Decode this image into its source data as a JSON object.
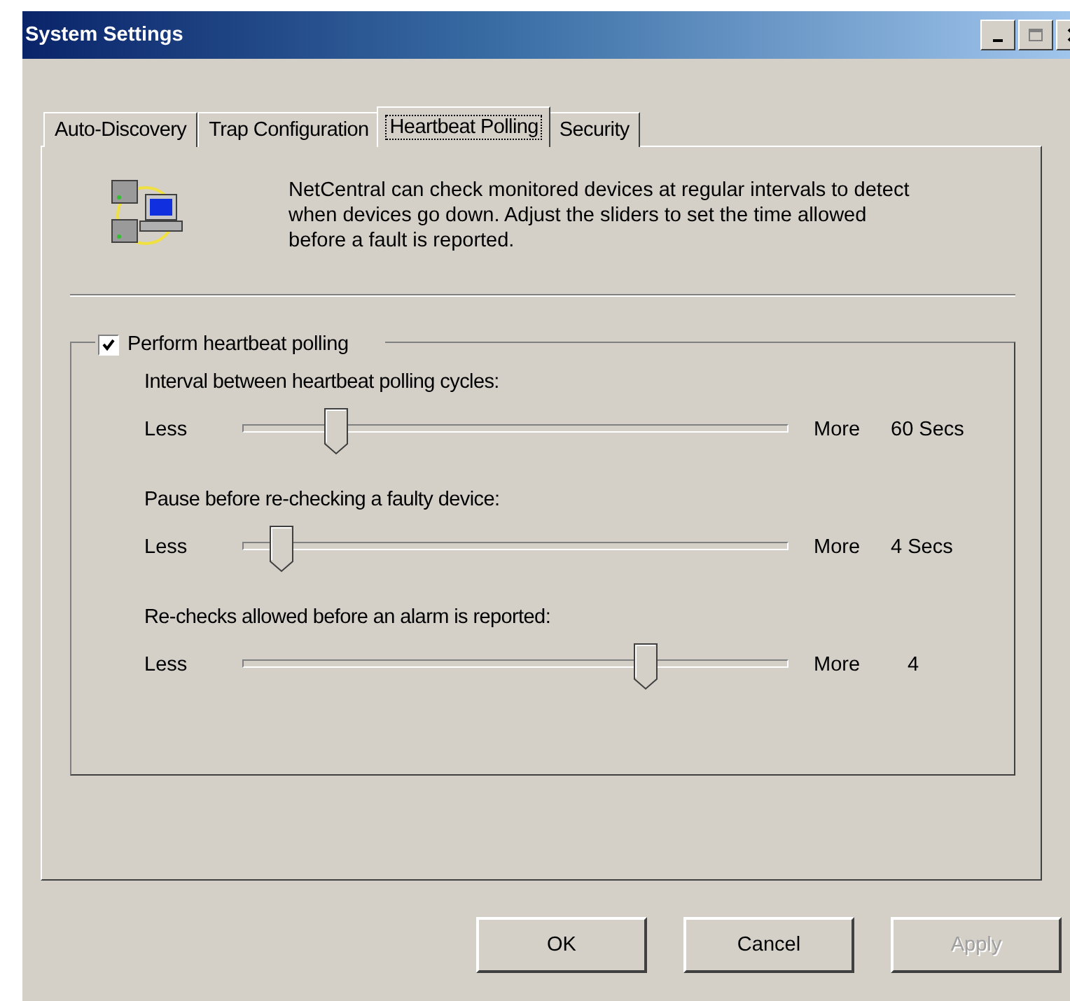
{
  "window": {
    "title": "System Settings"
  },
  "tabs": [
    {
      "label": "Auto-Discovery",
      "selected": false
    },
    {
      "label": "Trap Configuration",
      "selected": false
    },
    {
      "label": "Heartbeat Polling",
      "selected": true
    },
    {
      "label": "Security",
      "selected": false
    }
  ],
  "intro": "NetCentral can check monitored devices at regular intervals to detect when devices go down. Adjust the sliders to set the time allowed before a fault is reported.",
  "group": {
    "label": "Perform heartbeat polling",
    "checked": true
  },
  "sliders": [
    {
      "label": "Interval between heartbeat polling cycles:",
      "min_label": "Less",
      "max_label": "More",
      "level": 0.17,
      "reading": "60 Secs"
    },
    {
      "label": "Pause before re-checking a faulty device:",
      "min_label": "Less",
      "max_label": "More",
      "level": 0.07,
      "reading": "4 Secs"
    },
    {
      "label": "Re-checks allowed before an alarm is reported:",
      "min_label": "Less",
      "max_label": "More",
      "level": 0.74,
      "reading": "4"
    }
  ],
  "buttons": [
    {
      "label": "OK",
      "disabled": false
    },
    {
      "label": "Cancel",
      "disabled": false
    },
    {
      "label": "Apply",
      "disabled": true
    }
  ]
}
